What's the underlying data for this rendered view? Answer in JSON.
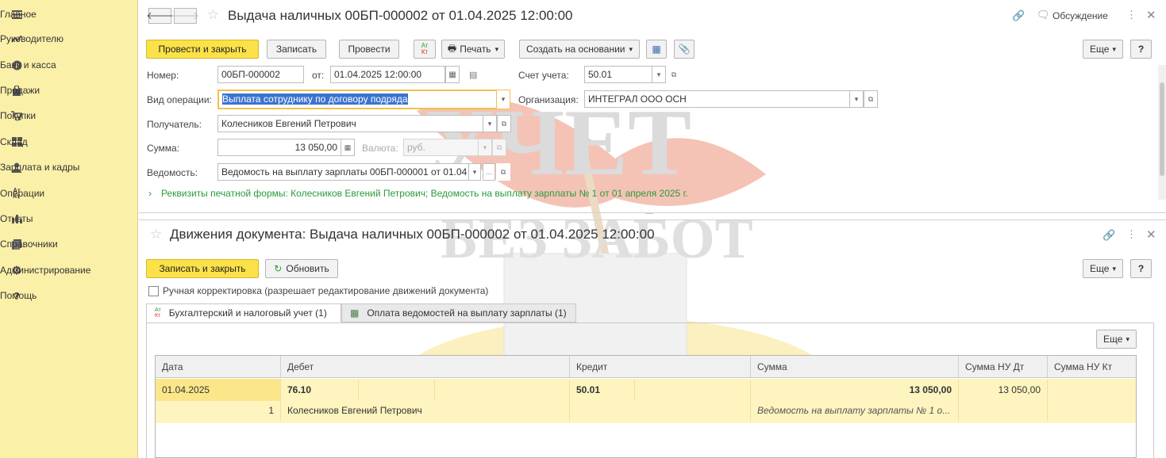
{
  "sidebar": {
    "items": [
      {
        "label": "Главное",
        "icon": "menu-icon"
      },
      {
        "label": "Руководителю",
        "icon": "trend-icon"
      },
      {
        "label": "Банк и касса",
        "icon": "coin-icon"
      },
      {
        "label": "Продажи",
        "icon": "bag-icon"
      },
      {
        "label": "Покупки",
        "icon": "cart-icon"
      },
      {
        "label": "Склад",
        "icon": "warehouse-icon"
      },
      {
        "label": "Зарплата и кадры",
        "icon": "person-icon"
      },
      {
        "label": "Операции",
        "icon": "dt-kt-icon"
      },
      {
        "label": "Отчеты",
        "icon": "bar-chart-icon"
      },
      {
        "label": "Справочники",
        "icon": "book-icon"
      },
      {
        "label": "Администрирование",
        "icon": "gear-icon"
      },
      {
        "label": "Помощь",
        "icon": "help-icon"
      }
    ]
  },
  "doc": {
    "title": "Выдача наличных 00БП-000002 от 01.04.2025 12:00:00",
    "discussion": "Обсуждение",
    "toolbar": {
      "post_close": "Провести и закрыть",
      "save": "Записать",
      "post": "Провести",
      "print": "Печать",
      "create_based": "Создать на основании",
      "more": "Еще",
      "help": "?",
      "dtkt_top": "Ат",
      "dtkt_bottom": "Кт"
    },
    "fields": {
      "number_label": "Номер:",
      "number_value": "00БП-000002",
      "date_label": "от:",
      "date_value": "01.04.2025 12:00:00",
      "account_label": "Счет учета:",
      "account_value": "50.01",
      "operation_label": "Вид операции:",
      "operation_value": "Выплата сотруднику по договору подряда",
      "org_label": "Организация:",
      "org_value": "ИНТЕГРАЛ ООО ОСН",
      "recipient_label": "Получатель:",
      "recipient_value": "Колесников Евгений Петрович",
      "sum_label": "Сумма:",
      "sum_value": "13 050,00",
      "currency_label": "Валюта:",
      "currency_value": "руб.",
      "statement_label": "Ведомость:",
      "statement_value": "Ведомость на выплату зарплаты 00БП-000001 от 01.04",
      "print_link": "Реквизиты печатной формы: Колесников Евгений Петрович; Ведомость на выплату зарплаты № 1 от 01 апреля 2025 г."
    }
  },
  "movements": {
    "title": "Движения документа: Выдача наличных 00БП-000002 от 01.04.2025 12:00:00",
    "save_close": "Записать и закрыть",
    "refresh": "Обновить",
    "more": "Еще",
    "help": "?",
    "manual_label": "Ручная корректировка (разрешает редактирование движений документа)",
    "tabs": [
      {
        "label": "Бухгалтерский и налоговый учет (1)"
      },
      {
        "label": "Оплата ведомостей на выплату зарплаты (1)"
      }
    ],
    "table_more": "Еще",
    "columns": [
      "Дата",
      "Дебет",
      "Кредит",
      "Сумма",
      "Сумма НУ Дт",
      "Сумма НУ Кт"
    ],
    "rows": [
      {
        "date": "01.04.2025",
        "debit": "76.10",
        "credit": "50.01",
        "sum": "13 050,00",
        "sum_nu_dt": "13 050,00",
        "sum_nu_kt": "",
        "line_no": "1",
        "debit_subconto": "Колесников Евгений Петрович",
        "content": "Ведомость на выплату зарплаты № 1 о..."
      }
    ]
  },
  "watermark": {
    "line1": "УЧЕТ",
    "line2": "БЕЗ ЗАБОТ"
  },
  "colors": {
    "sidebar": "#fbf0a8",
    "accent_button": "#fbe248",
    "link": "#2a9a3a",
    "selection": "#3b73d0"
  }
}
